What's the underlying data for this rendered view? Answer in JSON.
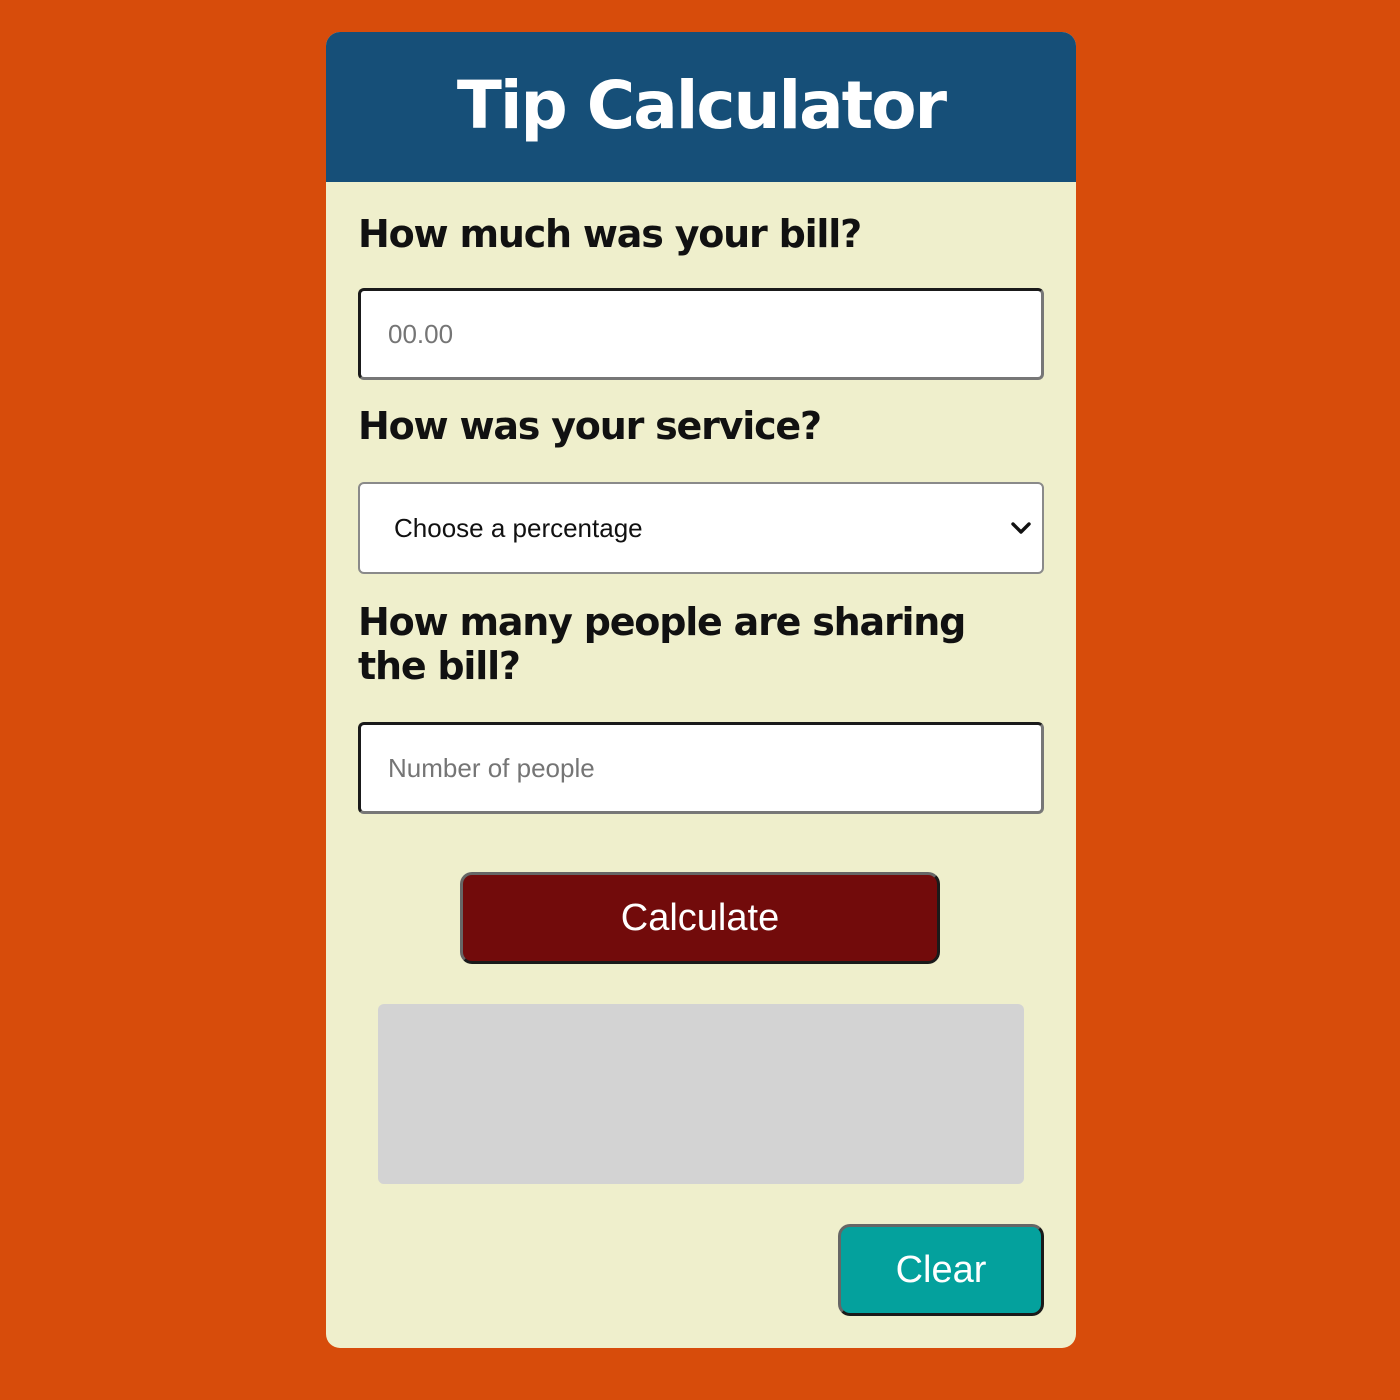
{
  "header": {
    "title": "Tip Calculator"
  },
  "bill": {
    "label": "How much was your bill?",
    "placeholder": "00.00",
    "value": ""
  },
  "service": {
    "label": "How was your service?",
    "selected": "Choose a percentage"
  },
  "people": {
    "label": "How many people are sharing the bill?",
    "placeholder": "Number of people",
    "value": ""
  },
  "actions": {
    "calculate_label": "Calculate",
    "clear_label": "Clear"
  },
  "result": {
    "text": ""
  },
  "colors": {
    "page_background": "#d74c0b",
    "card_background": "#efefcc",
    "header_background": "#164f78",
    "calculate_button": "#720b0b",
    "clear_button": "#04a19d",
    "result_box": "#d3d3d3"
  },
  "icons": {
    "select_arrow": "chevron-down-icon"
  }
}
